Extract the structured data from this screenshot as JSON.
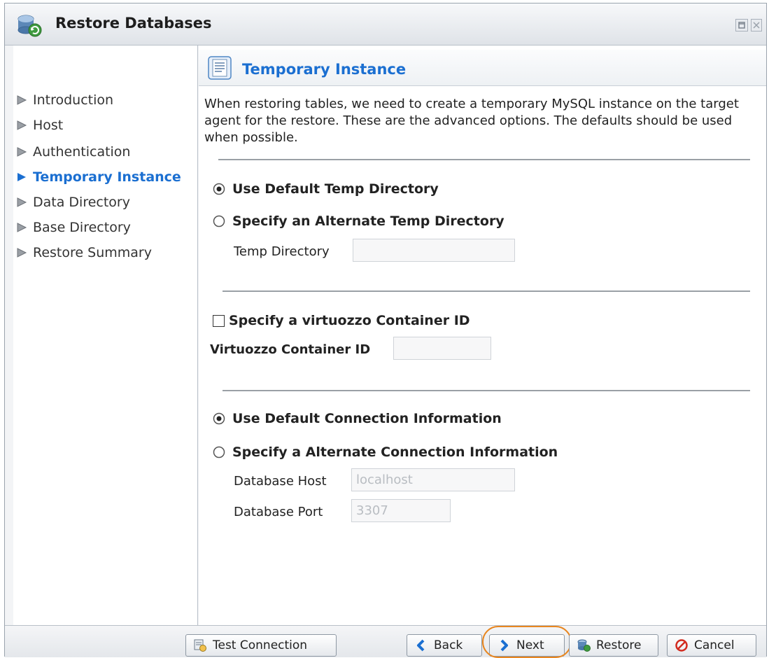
{
  "window": {
    "title": "Restore Databases",
    "title_icon": "database-restore-icon"
  },
  "sidebar": {
    "items": [
      {
        "label": "Introduction",
        "active": false
      },
      {
        "label": "Host",
        "active": false
      },
      {
        "label": "Authentication",
        "active": false
      },
      {
        "label": "Temporary Instance",
        "active": true
      },
      {
        "label": "Data Directory",
        "active": false
      },
      {
        "label": "Base Directory",
        "active": false
      },
      {
        "label": "Restore Summary",
        "active": false
      }
    ]
  },
  "panel": {
    "title": "Temporary Instance",
    "description": "When restoring tables, we need to create a temporary MySQL instance on the target agent for the restore. These are the advanced options. The defaults should be used when possible.",
    "temp_dir": {
      "default_label": "Use Default Temp Directory",
      "default_selected": true,
      "alternate_label": "Specify an Alternate Temp Directory",
      "field_label": "Temp Directory",
      "field_value": ""
    },
    "virtuozzo": {
      "checkbox_label": "Specify a virtuozzo Container ID",
      "checked": false,
      "field_label": "Virtuozzo Container ID",
      "field_value": ""
    },
    "connection": {
      "default_label": "Use Default Connection Information",
      "default_selected": true,
      "alternate_label": "Specify a Alternate Connection Information",
      "host_label": "Database Host",
      "host_placeholder": "localhost",
      "port_label": "Database Port",
      "port_placeholder": "3307"
    }
  },
  "footer": {
    "test_connection": "Test Connection",
    "back": "Back",
    "next": "Next",
    "restore": "Restore",
    "cancel": "Cancel"
  },
  "colors": {
    "accent": "#1b6fd1",
    "highlight": "#e8861f"
  }
}
